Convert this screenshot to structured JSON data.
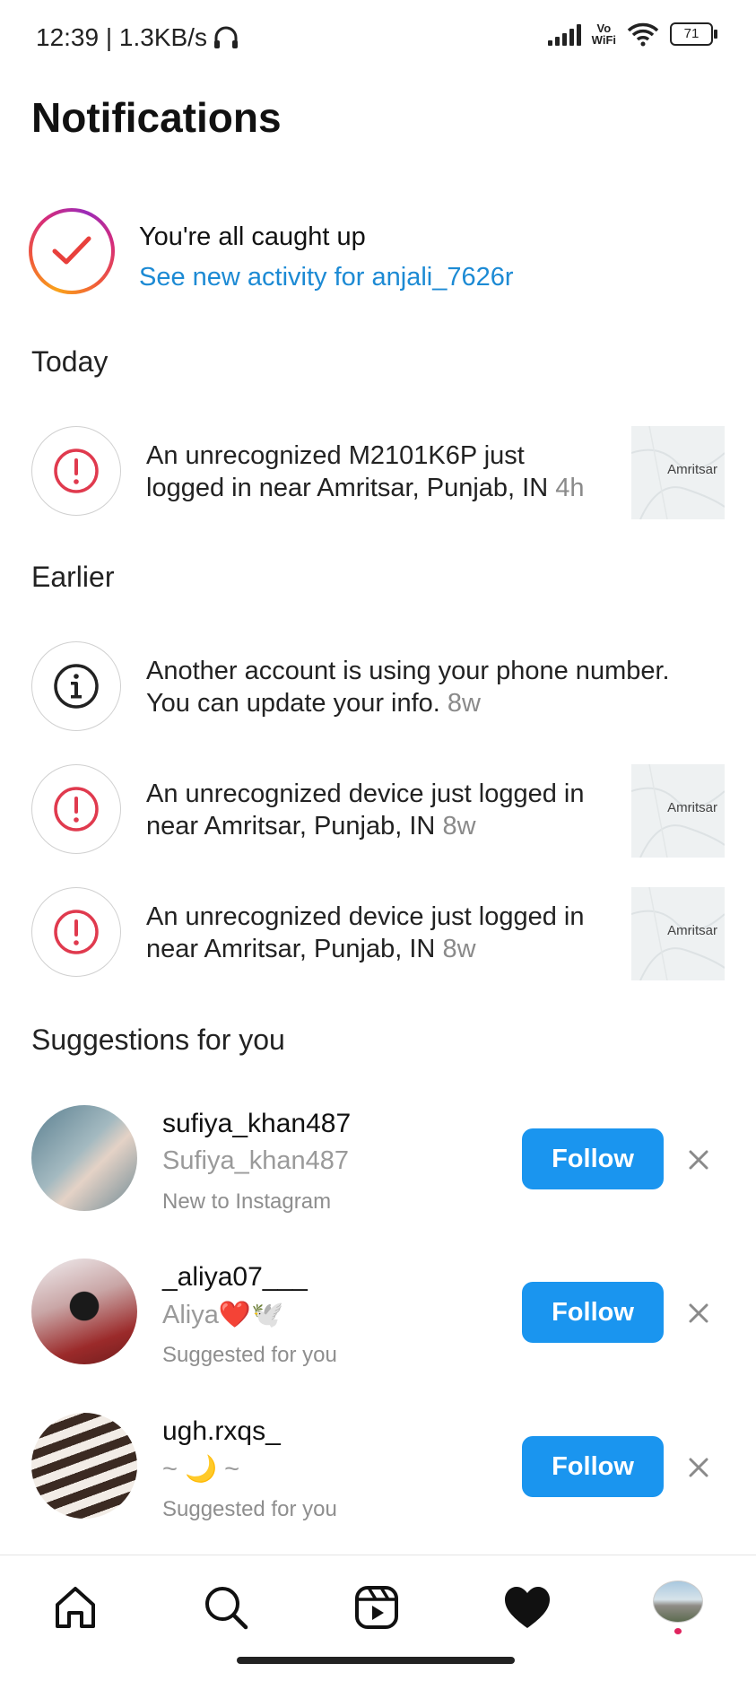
{
  "status_bar": {
    "time_text": "12:39 | 1.3KB/s",
    "vowifi_top": "Vo",
    "vowifi_bottom": "WiFi",
    "battery": "71"
  },
  "header": {
    "title": "Notifications"
  },
  "caught_up": {
    "title": "You're all caught up",
    "link": "See new activity for anjali_7626r"
  },
  "sections": {
    "today": "Today",
    "earlier": "Earlier",
    "suggestions": "Suggestions for you"
  },
  "notifications": [
    {
      "icon": "alert-icon",
      "line1": "An unrecognized M2101K6P just",
      "line2": "logged in near Amritsar, Punjab, IN",
      "time": "4h",
      "map_label": "Amritsar"
    },
    {
      "icon": "info-icon",
      "line1": "Another account is using your phone number.",
      "line2": "You can update your info.",
      "time": "8w"
    },
    {
      "icon": "alert-icon",
      "line1": "An unrecognized device just logged in",
      "line2": "near Amritsar, Punjab, IN",
      "time": "8w",
      "map_label": "Amritsar"
    },
    {
      "icon": "alert-icon",
      "line1": "An unrecognized device just logged in",
      "line2": "near Amritsar, Punjab, IN",
      "time": "8w",
      "map_label": "Amritsar"
    }
  ],
  "suggestions": [
    {
      "username": "sufiya_khan487",
      "name": "Sufiya_khan487",
      "note": "New to Instagram",
      "button": "Follow"
    },
    {
      "username": "_aliya07___",
      "name": "Aliya❤️🕊️",
      "note": "Suggested for you",
      "button": "Follow"
    },
    {
      "username": "ugh.rxqs_",
      "name": "~ 🌙 ~",
      "note": "Suggested for you",
      "button": "Follow"
    }
  ],
  "colors": {
    "accent_blue": "#1a95ef",
    "link_blue": "#1c8ad4",
    "alert_red": "#e03a4e",
    "notification_dot": "#e0245e"
  },
  "bottom_nav": [
    "home-icon",
    "search-icon",
    "reels-icon",
    "heart-icon",
    "profile-avatar"
  ]
}
